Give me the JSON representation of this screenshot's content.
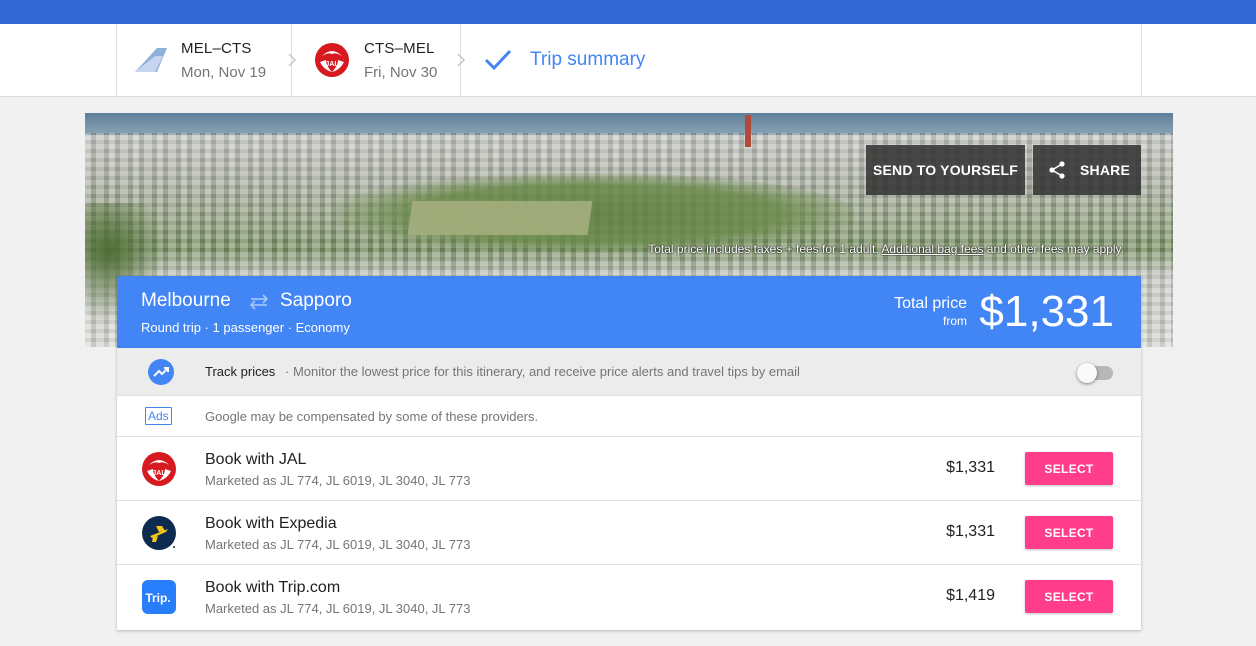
{
  "colors": {
    "accent": "#4285f4",
    "topbar": "#3367d6",
    "select_button": "#ff3d8b"
  },
  "steps": [
    {
      "route": "MEL–CTS",
      "date": "Mon, Nov 19",
      "icon": "generic-airline-icon"
    },
    {
      "route": "CTS–MEL",
      "date": "Fri, Nov 30",
      "icon": "jal-logo-icon"
    },
    {
      "label": "Trip summary",
      "icon": "checkmark-icon"
    }
  ],
  "hero": {
    "send_label": "SEND TO YOURSELF",
    "share_label": "SHARE",
    "note_prefix": "Total price includes taxes + fees for 1 adult. ",
    "note_link": "Additional bag fees",
    "note_suffix": " and other fees may apply."
  },
  "summary": {
    "from_city": "Melbourne",
    "to_city": "Sapporo",
    "meta": "Round trip · 1 passenger · Economy",
    "total_label": "Total price",
    "from_label": "from",
    "price": "$1,331"
  },
  "track": {
    "title": "Track prices",
    "desc": "· Monitor the lowest price for this itinerary, and receive price alerts and travel tips by email",
    "enabled": false
  },
  "ads": {
    "badge": "Ads",
    "text": "Google may be compensated by some of these providers."
  },
  "providers": [
    {
      "name": "Book with JAL",
      "marketed": "Marketed as JL 774, JL 6019, JL 3040, JL 773",
      "price": "$1,331",
      "button": "SELECT",
      "logo": "jal-logo-icon"
    },
    {
      "name": "Book with Expedia",
      "marketed": "Marketed as JL 774, JL 6019, JL 3040, JL 773",
      "price": "$1,331",
      "button": "SELECT",
      "logo": "expedia-logo-icon"
    },
    {
      "name": "Book with Trip.com",
      "marketed": "Marketed as JL 774, JL 6019, JL 3040, JL 773",
      "price": "$1,419",
      "button": "SELECT",
      "logo": "tripcom-logo-icon",
      "logo_text": "Trip."
    }
  ]
}
